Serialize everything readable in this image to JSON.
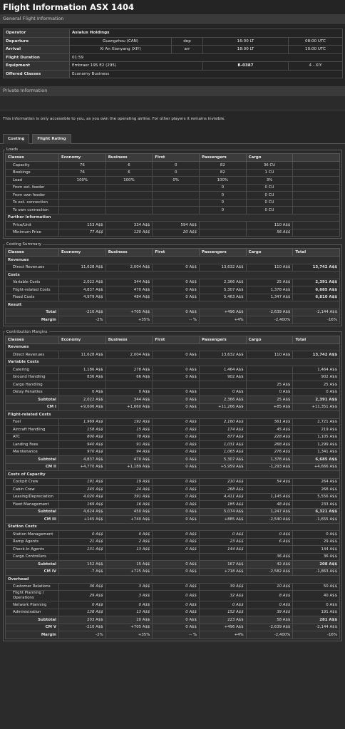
{
  "title": "Flight Information ASX 1404",
  "general_header": "General Flight Information",
  "general": {
    "operator_label": "Operator",
    "operator": "Asialux Holdings",
    "departure_label": "Departure",
    "departure_airport": "Guangzhou (CAN)",
    "dep_tag": "dep",
    "dep_lt": "16:00 LT",
    "dep_utc": "08:00 UTC",
    "arrival_label": "Arrival",
    "arrival_airport": "Xi An Xianyang (XIY)",
    "arr_tag": "arr",
    "arr_lt": "18:00 LT",
    "arr_utc": "10:00 UTC",
    "duration_label": "Flight Duration",
    "duration": "01:59",
    "equipment_label": "Equipment",
    "equipment": "Embraer 195 E2 (295)",
    "reg": "B-0387",
    "route": "4 - XIY",
    "classes_label": "Offered Classes",
    "classes": "Economy Business"
  },
  "private_header": "Private Information",
  "notice": "This information is only accessible to you, as you own the operating airline. For other players it remains invisible.",
  "tabs": [
    "Costing",
    "Flight Rating"
  ],
  "loads": {
    "legend": "Loads",
    "headers": [
      "Classes",
      "Economy",
      "Business",
      "First",
      "Passengers",
      "Cargo",
      ""
    ],
    "capacity": [
      "Capacity",
      "76",
      "6",
      "0",
      "82",
      "36 CU",
      ""
    ],
    "bookings": [
      "Bookings",
      "76",
      "6",
      "0",
      "82",
      "1 CU",
      ""
    ],
    "load": [
      "Load",
      "100%",
      "100%",
      "0%",
      "100%",
      "3%",
      ""
    ],
    "ext_feeder": [
      "From ext. feeder",
      "",
      "",
      "",
      "0",
      "0 CU",
      ""
    ],
    "own_feeder": [
      "From own feeder",
      "",
      "",
      "",
      "0",
      "0 CU",
      ""
    ],
    "to_ext": [
      "To ext. connection",
      "",
      "",
      "",
      "0",
      "0 CU",
      ""
    ],
    "to_own": [
      "To own connection",
      "",
      "",
      "",
      "0",
      "0 CU",
      ""
    ],
    "further": "Further Information",
    "price": [
      "Price/Unit",
      "153 A$$",
      "334 A$$",
      "594 A$$",
      "",
      "110 A$$",
      ""
    ],
    "min_price": [
      "Minimum Price",
      "77 A$$",
      "120 A$$",
      "20 A$$",
      "",
      "56 A$$",
      ""
    ]
  },
  "summary": {
    "legend": "Costing Summary",
    "headers": [
      "Classes",
      "Economy",
      "Business",
      "First",
      "Passengers",
      "Cargo",
      "Total"
    ],
    "revenues": "Revenues",
    "direct": [
      "Direct Revenues",
      "11,628 A$$",
      "2,004 A$$",
      "0 A$$",
      "13,632 A$$",
      "110 A$$",
      "13,742 A$$"
    ],
    "costs": "Costs",
    "variable": [
      "Variable Costs",
      "2,022 A$$",
      "344 A$$",
      "0 A$$",
      "2,366 A$$",
      "25 A$$",
      "2,391 A$$"
    ],
    "flight": [
      "Flight-related Costs",
      "4,837 A$$",
      "470 A$$",
      "0 A$$",
      "5,307 A$$",
      "1,378 A$$",
      "6,685 A$$"
    ],
    "fixed": [
      "Fixed Costs",
      "4,979 A$$",
      "484 A$$",
      "0 A$$",
      "5,463 A$$",
      "1,347 A$$",
      "6,810 A$$"
    ],
    "result": "Result",
    "total": [
      "Total",
      "-210 A$$",
      "+705 A$$",
      "0 A$$",
      "+496 A$$",
      "-2,639 A$$",
      "-2,144 A$$"
    ],
    "margin": [
      "Margin",
      "-2%",
      "+35%",
      "-- %",
      "+4%",
      "-2,400%",
      "-16%"
    ]
  },
  "contrib": {
    "legend": "Contribution Margins",
    "headers": [
      "Classes",
      "Economy",
      "Business",
      "First",
      "Passengers",
      "Cargo",
      "Total"
    ],
    "revenues": "Revenues",
    "direct": [
      "Direct Revenues",
      "11,628 A$$",
      "2,004 A$$",
      "0 A$$",
      "13,632 A$$",
      "110 A$$",
      "13,742 A$$"
    ],
    "variable_title": "Variable Costs",
    "catering": [
      "Catering",
      "1,186 A$$",
      "278 A$$",
      "0 A$$",
      "1,464 A$$",
      "",
      "1,464 A$$"
    ],
    "ground": [
      "Ground Handling",
      "836 A$$",
      "66 A$$",
      "0 A$$",
      "902 A$$",
      "",
      "902 A$$"
    ],
    "cargo_handling": [
      "Cargo Handling",
      "",
      "",
      "",
      "",
      "25 A$$",
      "25 A$$"
    ],
    "delay": [
      "Delay Penalties",
      "0 A$$",
      "0 A$$",
      "0 A$$",
      "0 A$$",
      "0 A$$",
      "0 A$$"
    ],
    "var_sub": [
      "Subtotal",
      "2,022 A$$",
      "344 A$$",
      "0 A$$",
      "2,366 A$$",
      "25 A$$",
      "2,391 A$$"
    ],
    "cm1": [
      "CM I",
      "+9,606 A$$",
      "+1,660 A$$",
      "0 A$$",
      "+11,266 A$$",
      "+85 A$$",
      "+11,351 A$$"
    ],
    "flight_title": "Flight-related Costs",
    "fuel": [
      "Fuel",
      "1,969 A$$",
      "192 A$$",
      "0 A$$",
      "2,160 A$$",
      "561 A$$",
      "2,721 A$$"
    ],
    "aircraft": [
      "Aircraft Handling",
      "158 A$$",
      "15 A$$",
      "0 A$$",
      "174 A$$",
      "45 A$$",
      "219 A$$"
    ],
    "atc": [
      "ATC",
      "800 A$$",
      "78 A$$",
      "0 A$$",
      "877 A$$",
      "228 A$$",
      "1,105 A$$"
    ],
    "landing": [
      "Landing Fees",
      "940 A$$",
      "91 A$$",
      "0 A$$",
      "1,031 A$$",
      "268 A$$",
      "1,299 A$$"
    ],
    "maintenance": [
      "Maintenance",
      "970 A$$",
      "94 A$$",
      "0 A$$",
      "1,065 A$$",
      "276 A$$",
      "1,341 A$$"
    ],
    "flight_sub": [
      "Subtotal",
      "4,837 A$$",
      "470 A$$",
      "0 A$$",
      "5,307 A$$",
      "1,378 A$$",
      "6,685 A$$"
    ],
    "cm2": [
      "CM II",
      "+4,770 A$$",
      "+1,189 A$$",
      "0 A$$",
      "+5,959 A$$",
      "-1,293 A$$",
      "+4,666 A$$"
    ],
    "capacity_title": "Costs of Capacity",
    "cockpit": [
      "Cockpit Crew",
      "191 A$$",
      "19 A$$",
      "0 A$$",
      "210 A$$",
      "54 A$$",
      "264 A$$"
    ],
    "cabin": [
      "Cabin Crew",
      "245 A$$",
      "24 A$$",
      "0 A$$",
      "268 A$$",
      "",
      "268 A$$"
    ],
    "leasing": [
      "Leasing/Depreciation",
      "4,020 A$$",
      "391 A$$",
      "0 A$$",
      "4,411 A$$",
      "1,145 A$$",
      "5,556 A$$"
    ],
    "fleet": [
      "Fleet Management",
      "169 A$$",
      "16 A$$",
      "0 A$$",
      "185 A$$",
      "48 A$$",
      "233 A$$"
    ],
    "cap_sub": [
      "Subtotal",
      "4,624 A$$",
      "450 A$$",
      "0 A$$",
      "5,074 A$$",
      "1,247 A$$",
      "6,321 A$$"
    ],
    "cm3": [
      "CM III",
      "+145 A$$",
      "+740 A$$",
      "0 A$$",
      "+885 A$$",
      "-2,540 A$$",
      "-1,655 A$$"
    ],
    "station_title": "Station Costs",
    "station_mgmt": [
      "Station Management",
      "0 A$$",
      "0 A$$",
      "0 A$$",
      "0 A$$",
      "0 A$$",
      "0 A$$"
    ],
    "ramp": [
      "Ramp Agents",
      "21 A$$",
      "2 A$$",
      "0 A$$",
      "23 A$$",
      "6 A$$",
      "29 A$$"
    ],
    "checkin": [
      "Check-In Agents",
      "131 A$$",
      "13 A$$",
      "0 A$$",
      "144 A$$",
      "",
      "144 A$$"
    ],
    "cargo_ctrl": [
      "Cargo Controllers",
      "",
      "",
      "",
      "",
      "36 A$$",
      "36 A$$"
    ],
    "station_sub": [
      "Subtotal",
      "152 A$$",
      "15 A$$",
      "0 A$$",
      "167 A$$",
      "42 A$$",
      "208 A$$"
    ],
    "cm4": [
      "CM IV",
      "-7 A$$",
      "+725 A$$",
      "0 A$$",
      "+718 A$$",
      "-2,582 A$$",
      "-1,863 A$$"
    ],
    "overhead_title": "Overhead",
    "customer": [
      "Customer Relations",
      "36 A$$",
      "3 A$$",
      "0 A$$",
      "39 A$$",
      "10 A$$",
      "50 A$$"
    ],
    "planning": [
      "Flight Planning / Operations",
      "29 A$$",
      "3 A$$",
      "0 A$$",
      "32 A$$",
      "8 A$$",
      "40 A$$"
    ],
    "network": [
      "Network Planning",
      "0 A$$",
      "0 A$$",
      "0 A$$",
      "0 A$$",
      "0 A$$",
      "0 A$$"
    ],
    "admin": [
      "Administration",
      "138 A$$",
      "13 A$$",
      "0 A$$",
      "152 A$$",
      "39 A$$",
      "191 A$$"
    ],
    "over_sub": [
      "Subtotal",
      "203 A$$",
      "20 A$$",
      "0 A$$",
      "223 A$$",
      "58 A$$",
      "281 A$$"
    ],
    "cm5": [
      "CM V",
      "-210 A$$",
      "+705 A$$",
      "0 A$$",
      "+496 A$$",
      "-2,639 A$$",
      "-2,144 A$$"
    ],
    "margin": [
      "Margin",
      "-2%",
      "+35%",
      "-- %",
      "+4%",
      "-2,400%",
      "-16%"
    ]
  },
  "colors": {
    "positive": "#6ac26a",
    "negative": "#e05a4a",
    "background": "#2b2b2b"
  }
}
